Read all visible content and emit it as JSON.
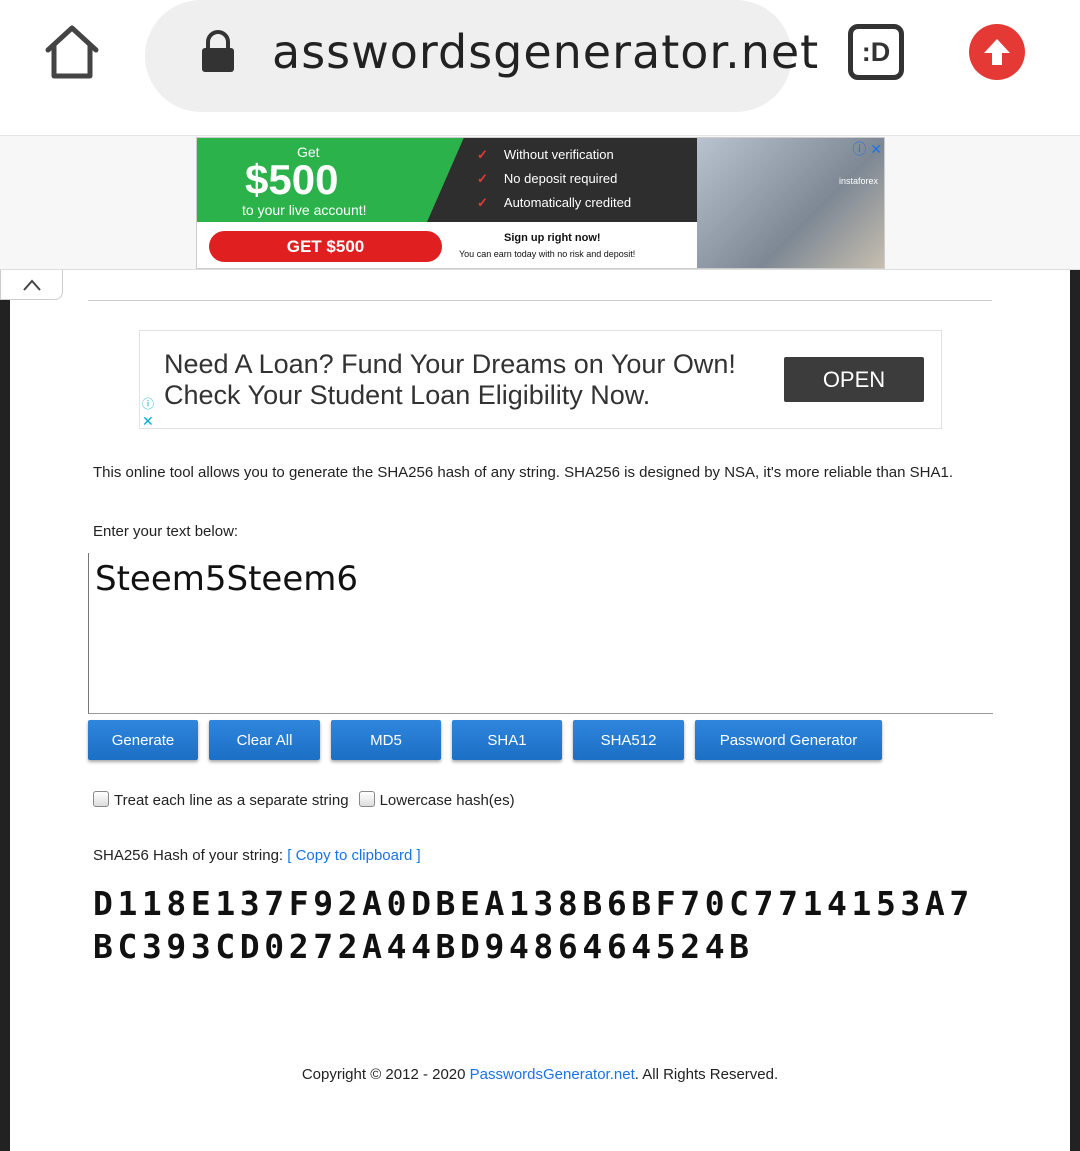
{
  "browser": {
    "url": "asswordsgenerator.net",
    "tab_label": ":D"
  },
  "ad_top": {
    "get": "Get",
    "amount": "$500",
    "live": "to your live account!",
    "checks": [
      "Without verification",
      "No deposit required",
      "Automatically credited"
    ],
    "cta": "GET $500",
    "signup": "Sign up right now!",
    "earn": "You can earn today with no risk and deposit!",
    "brand": "instaforex"
  },
  "ad_loan": {
    "line1": "Need A Loan? Fund Your Dreams on Your Own!",
    "line2": "Check Your Student Loan Eligibility Now.",
    "open": "OPEN"
  },
  "tool": {
    "description": "This online tool allows you to generate the SHA256 hash of any string. SHA256 is designed by NSA, it's more reliable than SHA1.",
    "prompt": "Enter your text below:",
    "input_value": "Steem5Steem6",
    "buttons": {
      "generate": "Generate",
      "clear": "Clear All",
      "md5": "MD5",
      "sha1": "SHA1",
      "sha512": "SHA512",
      "password": "Password Generator"
    },
    "options": {
      "separate": "Treat each line as a separate string",
      "lowercase": "Lowercase hash(es)"
    },
    "result_label": "SHA256 Hash of your string:",
    "copy_link": "[ Copy to clipboard ]",
    "hash": "D118E137F92A0DBEA138B6BF70C7714153A7BC393CD0272A44BD9486464524B"
  },
  "footer": {
    "prefix": "Copyright © 2012 - 2020 ",
    "link": "PasswordsGenerator.net",
    "suffix": ". All Rights Reserved."
  },
  "colors": {
    "accent": "#1b6fc4",
    "link": "#1a73e8",
    "upgrade": "#e53935"
  }
}
